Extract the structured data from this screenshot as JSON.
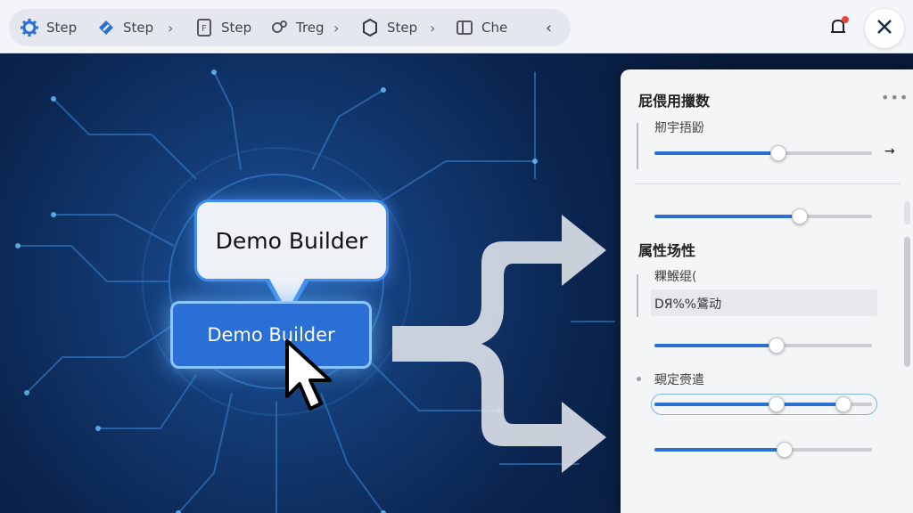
{
  "toolbar": {
    "steps": [
      {
        "label": "Step",
        "icon": "gear-icon"
      },
      {
        "label": "Step",
        "icon": "pen-icon"
      },
      {
        "label": "Step",
        "icon": "document-icon"
      },
      {
        "label": "Treg",
        "icon": "settings-cog-icon"
      },
      {
        "label": "Step",
        "icon": "box-icon"
      },
      {
        "label": "Che",
        "icon": "layout-icon"
      }
    ],
    "accent": "#2a6fd6"
  },
  "scene": {
    "bubble_text": "Demo Builder",
    "button_label": "Demo Builder"
  },
  "panel": {
    "section1_title": "屁偎用擸数",
    "section1_label": "剏宇捂鼢",
    "section2_title": "属性场性",
    "field_label": "粿鯸绲(",
    "field_value": "DЯ%%鷟动",
    "range_label": "覡定赍遣",
    "sliders": [
      {
        "name": "slider-1",
        "value": 0.57
      },
      {
        "name": "slider-2",
        "value": 0.67
      },
      {
        "name": "slider-3",
        "value": 0.56
      },
      {
        "name": "slider-4",
        "value": 0.6
      }
    ],
    "range": {
      "low": 0.56,
      "high": 0.87
    }
  }
}
